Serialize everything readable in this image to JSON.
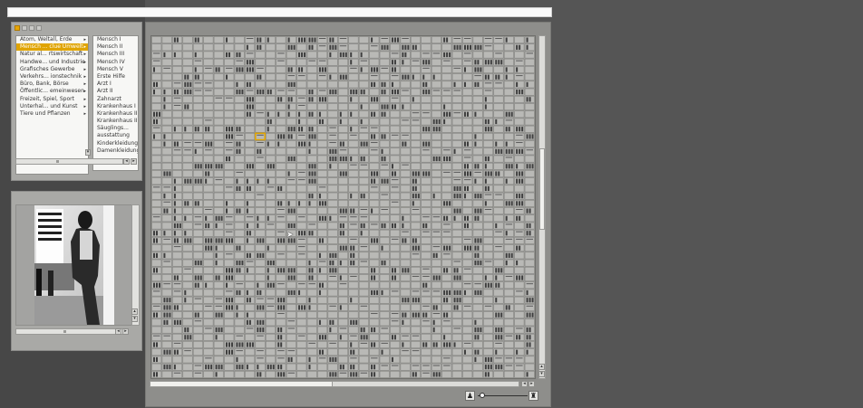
{
  "categories": {
    "level1": [
      {
        "label": "Atom, Weltall, Erde"
      },
      {
        "label": "Mensch ... clue Umwelt",
        "selected": true
      },
      {
        "label": "Natur al... rtswirtschaft"
      },
      {
        "label": "Handwe... und Industrie"
      },
      {
        "label": "Grafisches Gewerbe"
      },
      {
        "label": "Verkehrs... ionstechnik"
      },
      {
        "label": "Büro, Bank, Börse"
      },
      {
        "label": "Öffentlic... emeinwesen"
      },
      {
        "label": "Freizeit, Spiel, Sport"
      },
      {
        "label": "Unterhal... und Kunst"
      },
      {
        "label": "Tiere und Pflanzen"
      }
    ],
    "level2": [
      "Mensch I",
      "Mensch II",
      "Mensch III",
      "Mensch IV",
      "Mensch V",
      "Erste Hilfe",
      "Arzt I",
      "Arzt II",
      "Zahnarzt",
      "Krankenhaus I",
      "Krankenhaus II",
      "Krankenhaus III",
      "Säuglings...",
      "ausstattung",
      "Kinderkleidung",
      "Damenkleidung I"
    ]
  },
  "colors": {
    "accent": "#e0a400",
    "grid_bg": "#a6a6a3",
    "cell_face": "#b9b9b6",
    "cell_edge": "#7c7c79",
    "glyph": "#3e3e3e"
  },
  "icons": {
    "zoom_out": "person-small-icon",
    "zoom_in": "person-large-icon"
  },
  "grid": {
    "selected_row": 13,
    "selected_col": 10
  }
}
